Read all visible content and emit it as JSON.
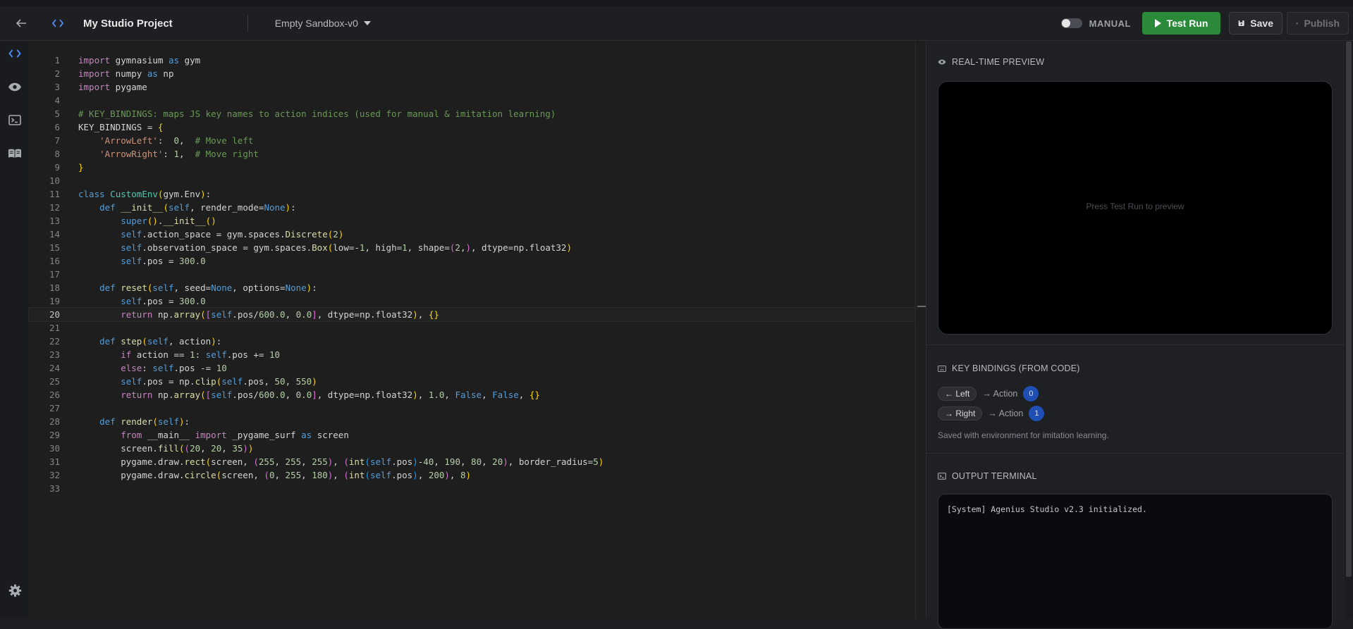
{
  "header": {
    "project_title": "My Studio Project",
    "environment": "Empty Sandbox-v0",
    "manual_label": "MANUAL",
    "test_run_label": "Test Run",
    "save_label": "Save",
    "publish_label": "Publish"
  },
  "sidebar": {
    "items": [
      {
        "icon": "code-icon"
      },
      {
        "icon": "eye-icon"
      },
      {
        "icon": "terminal-icon"
      },
      {
        "icon": "book-icon"
      },
      {
        "icon": "gear-icon"
      }
    ]
  },
  "editor": {
    "active_line": 20,
    "lines": [
      "import gymnasium as gym",
      "import numpy as np",
      "import pygame",
      "",
      "# KEY_BINDINGS: maps JS key names to action indices (used for manual & imitation learning)",
      "KEY_BINDINGS = {",
      "    'ArrowLeft':  0,  # Move left",
      "    'ArrowRight': 1,  # Move right",
      "}",
      "",
      "class CustomEnv(gym.Env):",
      "    def __init__(self, render_mode=None):",
      "        super().__init__()",
      "        self.action_space = gym.spaces.Discrete(2)",
      "        self.observation_space = gym.spaces.Box(low=-1, high=1, shape=(2,), dtype=np.float32)",
      "        self.pos = 300.0",
      "",
      "    def reset(self, seed=None, options=None):",
      "        self.pos = 300.0",
      "        return np.array([self.pos/600.0, 0.0], dtype=np.float32), {}",
      "",
      "    def step(self, action):",
      "        if action == 1: self.pos += 10",
      "        else: self.pos -= 10",
      "        self.pos = np.clip(self.pos, 50, 550)",
      "        return np.array([self.pos/600.0, 0.0], dtype=np.float32), 1.0, False, False, {}",
      "",
      "    def render(self):",
      "        from __main__ import _pygame_surf as screen",
      "        screen.fill((20, 20, 35))",
      "        pygame.draw.rect(screen, (255, 255, 255), (int(self.pos)-40, 190, 80, 20), border_radius=5)",
      "        pygame.draw.circle(screen, (0, 255, 180), (int(self.pos), 200), 8)",
      ""
    ]
  },
  "preview": {
    "title": "REAL-TIME PREVIEW",
    "placeholder": "Press Test Run to preview"
  },
  "key_bindings": {
    "title": "KEY BINDINGS (FROM CODE)",
    "items": [
      {
        "key": "← Left",
        "arrow_text": "→ Action",
        "action": "0"
      },
      {
        "key": "→ Right",
        "arrow_text": "→ Action",
        "action": "1"
      }
    ],
    "note": "Saved with environment for imitation learning."
  },
  "terminal": {
    "title": "OUTPUT TERMINAL",
    "lines": [
      "[System] Agenius Studio v2.3 initialized."
    ]
  },
  "colors": {
    "accent_green": "#2a8a3a",
    "accent_blue": "#4f8ff7",
    "badge_blue": "#1f4fb5"
  }
}
